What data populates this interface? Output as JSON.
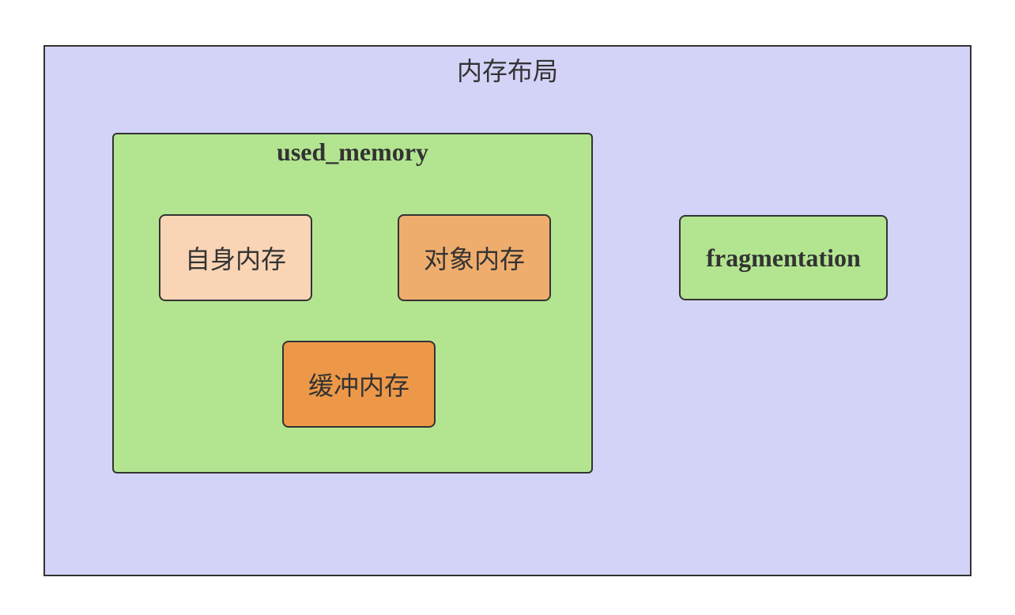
{
  "diagram": {
    "outer_group": {
      "title": "内存布局",
      "fill": "#d3d3f8"
    },
    "used_memory_group": {
      "title": "used_memory",
      "fill": "#b3e590"
    },
    "nodes": {
      "self_memory": {
        "label": "自身内存",
        "fill": "#f9d4b5"
      },
      "object_memory": {
        "label": "对象内存",
        "fill": "#efad6d"
      },
      "buffer_memory": {
        "label": "缓冲内存",
        "fill": "#ed9848"
      },
      "fragmentation": {
        "label": "fragmentation",
        "fill": "#b3e590"
      }
    },
    "border_color": "#333333"
  }
}
